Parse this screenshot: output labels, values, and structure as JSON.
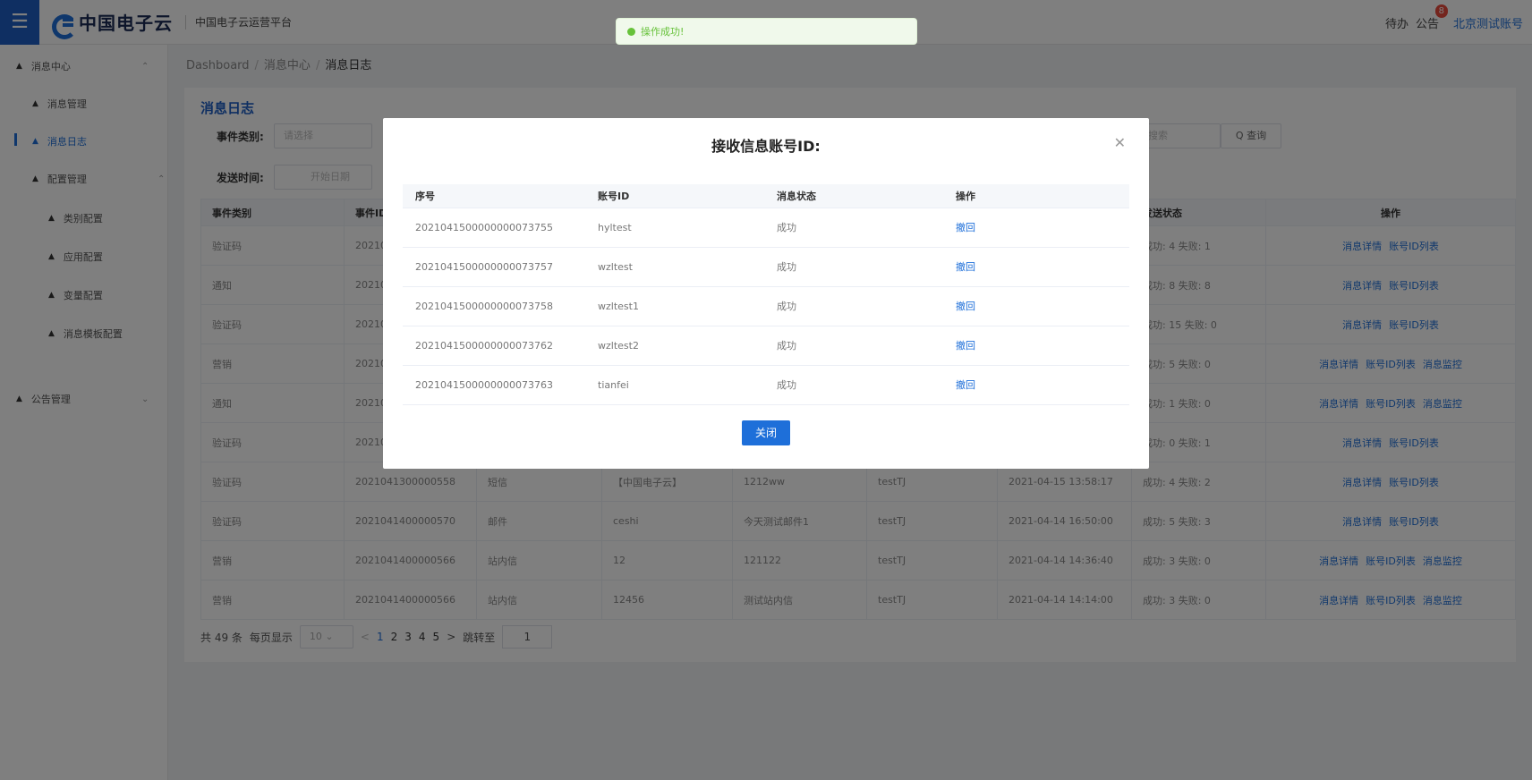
{
  "header": {
    "logo_text": "中国电子云",
    "platform_name": "中国电子云运营平台",
    "todo": "待办",
    "notice": "公告",
    "notice_badge": "8",
    "account": "北京测试账号"
  },
  "toast": {
    "message": "操作成功!"
  },
  "sidebar": {
    "items": [
      {
        "label": "消息中心"
      },
      {
        "label": "消息管理"
      },
      {
        "label": "消息日志"
      },
      {
        "label": "配置管理"
      },
      {
        "label": "类别配置"
      },
      {
        "label": "应用配置"
      },
      {
        "label": "变量配置"
      },
      {
        "label": "消息模板配置"
      },
      {
        "label": "公告管理"
      }
    ]
  },
  "breadcrumb": {
    "root": "Dashboard",
    "mid": "消息中心",
    "current": "消息日志"
  },
  "page": {
    "title": "消息日志",
    "event_type_label": "事件类别:",
    "event_type_placeholder": "请选择",
    "send_time_label": "发送时间:",
    "start_date_placeholder": "开始日期",
    "search_placeholder": "搜索",
    "query_button": "Q 查询"
  },
  "table": {
    "headers": [
      "事件类别",
      "事件ID",
      "",
      "",
      "",
      "",
      "",
      "发送状态",
      "操作"
    ],
    "rows": [
      {
        "type": "验证码",
        "id": "202104",
        "c3": "",
        "c4": "",
        "c5": "",
        "c6": "",
        "c7": "",
        "status": "成功: 4  失败: 1",
        "ops": [
          "消息详情",
          "账号ID列表"
        ]
      },
      {
        "type": "通知",
        "id": "202104",
        "c3": "",
        "c4": "",
        "c5": "",
        "c6": "",
        "c7": "",
        "status": "成功: 8  失败: 8",
        "ops": [
          "消息详情",
          "账号ID列表"
        ]
      },
      {
        "type": "验证码",
        "id": "202104",
        "c3": "",
        "c4": "",
        "c5": "",
        "c6": "",
        "c7": "",
        "status": "成功: 15  失败: 0",
        "ops": [
          "消息详情",
          "账号ID列表"
        ]
      },
      {
        "type": "营销",
        "id": "202104",
        "c3": "",
        "c4": "",
        "c5": "",
        "c6": "",
        "c7": "",
        "status": "成功: 5  失败: 0",
        "ops": [
          "消息详情",
          "账号ID列表",
          "消息监控"
        ]
      },
      {
        "type": "通知",
        "id": "202104",
        "c3": "",
        "c4": "",
        "c5": "",
        "c6": "",
        "c7": "",
        "status": "成功: 1  失败: 0",
        "ops": [
          "消息详情",
          "账号ID列表",
          "消息监控"
        ]
      },
      {
        "type": "验证码",
        "id": "202104",
        "c3": "",
        "c4": "",
        "c5": "",
        "c6": "",
        "c7": "",
        "status": "成功: 0  失败: 1",
        "ops": [
          "消息详情",
          "账号ID列表"
        ]
      },
      {
        "type": "验证码",
        "id": "2021041300000558",
        "c3": "短信",
        "c4": "【中国电子云】",
        "c5": "1212ww",
        "c6": "testTJ",
        "c7": "2021-04-15 13:58:17",
        "status": "成功: 4  失败: 2",
        "ops": [
          "消息详情",
          "账号ID列表"
        ]
      },
      {
        "type": "验证码",
        "id": "2021041400000570",
        "c3": "邮件",
        "c4": "ceshi",
        "c5": "今天测试邮件1",
        "c6": "testTJ",
        "c7": "2021-04-14 16:50:00",
        "status": "成功: 5  失败: 3",
        "ops": [
          "消息详情",
          "账号ID列表"
        ]
      },
      {
        "type": "营销",
        "id": "2021041400000566",
        "c3": "站内信",
        "c4": "12",
        "c5": "121122",
        "c6": "testTJ",
        "c7": "2021-04-14 14:36:40",
        "status": "成功: 3  失败: 0",
        "ops": [
          "消息详情",
          "账号ID列表",
          "消息监控"
        ]
      },
      {
        "type": "营销",
        "id": "2021041400000566",
        "c3": "站内信",
        "c4": "12456",
        "c5": "测试站内信",
        "c6": "testTJ",
        "c7": "2021-04-14 14:14:00",
        "status": "成功: 3  失败: 0",
        "ops": [
          "消息详情",
          "账号ID列表",
          "消息监控"
        ]
      }
    ]
  },
  "pager": {
    "total": "共 49 条",
    "per_page_label": "每页显示",
    "per_page": "10",
    "pages": [
      "1",
      "2",
      "3",
      "4",
      "5"
    ],
    "prev": "<",
    "next": ">",
    "goto_label": "跳转至",
    "goto_value": "1"
  },
  "modal": {
    "title": "接收信息账号ID:",
    "headers": [
      "序号",
      "账号ID",
      "消息状态",
      "操作"
    ],
    "rows": [
      {
        "seq": "2021041500000000073755",
        "account": "hyltest",
        "status": "成功",
        "action": "撤回"
      },
      {
        "seq": "2021041500000000073757",
        "account": "wzltest",
        "status": "成功",
        "action": "撤回"
      },
      {
        "seq": "2021041500000000073758",
        "account": "wzltest1",
        "status": "成功",
        "action": "撤回"
      },
      {
        "seq": "2021041500000000073762",
        "account": "wzltest2",
        "status": "成功",
        "action": "撤回"
      },
      {
        "seq": "2021041500000000073763",
        "account": "tianfei",
        "status": "成功",
        "action": "撤回"
      }
    ],
    "close_button": "关闭"
  },
  "colors": {
    "primary": "#1e6fd9",
    "header_bar": "#1e5fc4",
    "success": "#67c23a",
    "badge": "#e84a3c"
  }
}
